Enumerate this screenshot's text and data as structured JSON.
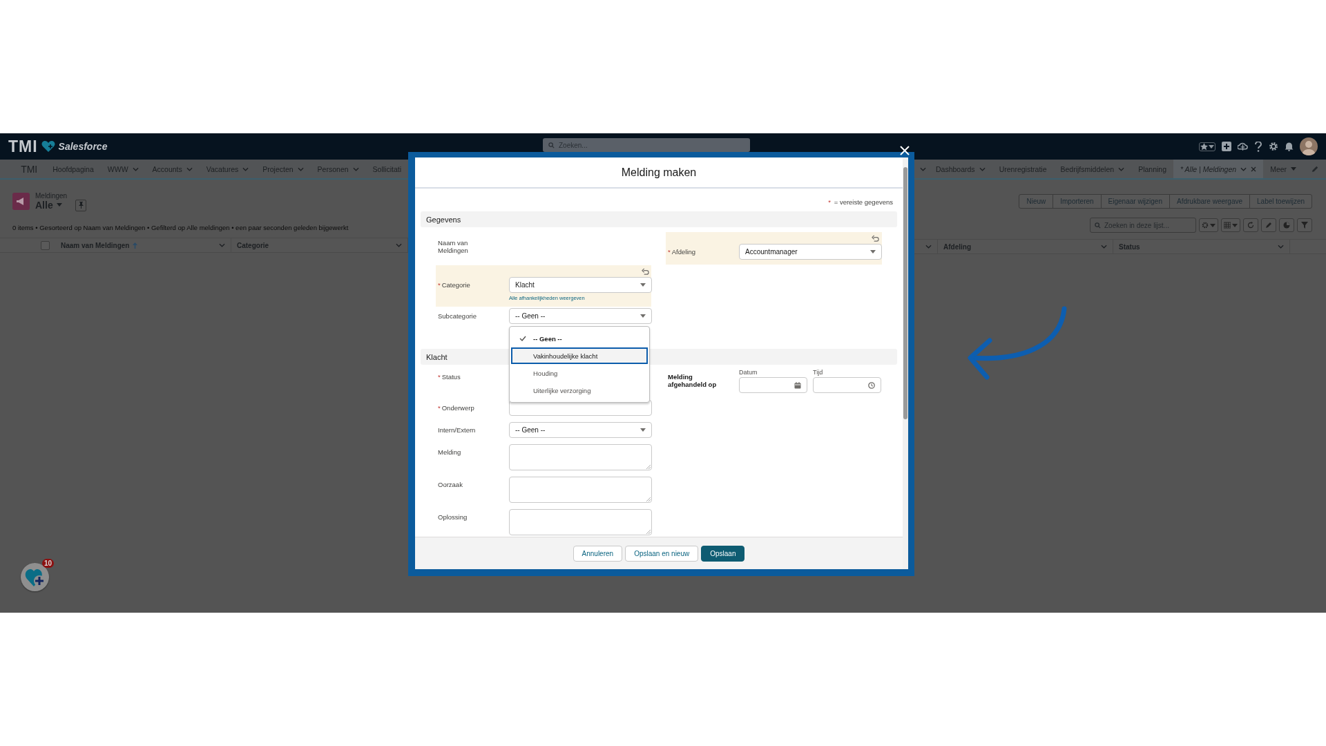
{
  "header": {
    "logo": "TMI",
    "brand": "Salesforce",
    "search": {
      "placeholder": "Zoeken..."
    }
  },
  "nav": {
    "app_name": "TMI",
    "items_left": [
      {
        "kind": "tab",
        "label": "Hoofdpagina",
        "menu": false,
        "selected": false
      },
      {
        "kind": "tab",
        "label": "WWW",
        "menu": true,
        "selected": false
      },
      {
        "kind": "tab",
        "label": "Accounts",
        "menu": true,
        "selected": false
      },
      {
        "kind": "tab",
        "label": "Vacatures",
        "menu": true,
        "selected": false
      },
      {
        "kind": "tab",
        "label": "Projecten",
        "menu": true,
        "selected": false
      },
      {
        "kind": "tab",
        "label": "Personen",
        "menu": true,
        "selected": false
      },
      {
        "kind": "tab",
        "label": "Sollicitati",
        "menu": false,
        "selected": false
      }
    ],
    "items_right": [
      {
        "kind": "tab",
        "label": "Dashboards",
        "menu": true,
        "selected": false
      },
      {
        "kind": "tab",
        "label": "Urenregistratie",
        "menu": false,
        "selected": false
      },
      {
        "kind": "tab",
        "label": "Bedrijfsmiddelen",
        "menu": true,
        "selected": false
      },
      {
        "kind": "tab",
        "label": "Planning",
        "menu": false,
        "selected": false
      },
      {
        "kind": "tab",
        "label": "* Alle | Meldingen",
        "menu": true,
        "selected": true
      },
      {
        "kind": "more",
        "label": "Meer",
        "menu": true,
        "selected": false
      }
    ]
  },
  "list": {
    "object_label": "Meldingen",
    "view": "Alle",
    "info": "0 items • Gesorteerd op Naam van Meldingen • Gefilterd op Alle meldingen • een paar seconden geleden bijgewerkt",
    "actions": [
      "Nieuw",
      "Importeren",
      "Eigenaar wijzigen",
      "Afdrukbare weergave",
      "Label toewijzen"
    ],
    "search": {
      "placeholder": "Zoeken in deze lijst..."
    },
    "select_all": {
      "checked": false
    },
    "columns_left": [
      {
        "label": "Naam van Meldingen",
        "sorted": true
      },
      {
        "label": "Categorie",
        "sorted": false
      }
    ],
    "columns_right": [
      {
        "label": "Afdeling",
        "sorted": false
      },
      {
        "label": "Status",
        "sorted": false
      }
    ]
  },
  "modal": {
    "title": "Melding maken",
    "legend": {
      "mark": "*",
      "text": "= vereiste gegevens"
    },
    "gegevens": {
      "title": "Gegevens",
      "name_label": "Naam van Meldingen",
      "afdeling": {
        "required_mark": "*",
        "label": "Afdeling",
        "changed": true,
        "value": "Accountmanager"
      },
      "categorie": {
        "required_mark": "*",
        "label": "Categorie",
        "changed": true,
        "value": "Klacht",
        "link": "Alle afhankelijkheden weergeven"
      },
      "subcategorie": {
        "label": "Subcategorie",
        "value": "-- Geen --",
        "open": true,
        "options": [
          {
            "label": "-- Geen --",
            "selected": true,
            "focused": false
          },
          {
            "label": "Vakinhoudelijke klacht",
            "selected": false,
            "focused": true
          },
          {
            "label": "Houding",
            "selected": false,
            "focused": false
          },
          {
            "label": "Uiterlijke verzorging",
            "selected": false,
            "focused": false
          }
        ]
      }
    },
    "klacht": {
      "title": "Klacht",
      "status": {
        "required_mark": "*",
        "label": "Status"
      },
      "handled": {
        "label": "Melding afgehandeld op",
        "date_label": "Datum",
        "time_label": "Tijd"
      },
      "fields": [
        {
          "kind": "input",
          "required_mark": "*",
          "label": "Onderwerp"
        },
        {
          "kind": "select",
          "label": "Intern/Extern",
          "value": "-- Geen --"
        },
        {
          "kind": "textarea",
          "label": "Melding"
        },
        {
          "kind": "textarea",
          "label": "Oorzaak"
        },
        {
          "kind": "textarea",
          "label": "Oplossing"
        }
      ]
    },
    "buttons": [
      {
        "label": "Annuleren",
        "primary": false
      },
      {
        "label": "Opslaan en nieuw",
        "primary": false
      },
      {
        "label": "Opslaan",
        "primary": true
      }
    ]
  },
  "fab": {
    "badge": "10"
  }
}
